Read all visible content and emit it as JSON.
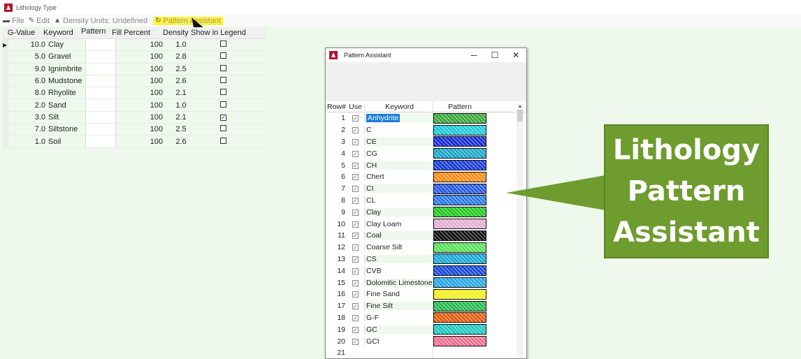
{
  "window": {
    "title": "Lithology Type"
  },
  "menu": {
    "items": [
      {
        "label": "File",
        "icon": "file-icon"
      },
      {
        "label": "Edit",
        "icon": "edit-icon"
      },
      {
        "label": "Density Units: Undefined",
        "icon": "weight-icon"
      },
      {
        "label": "Pattern Assistant",
        "icon": "refresh-icon"
      }
    ]
  },
  "grid": {
    "columns": [
      "G-Value",
      "Keyword",
      "Pattern",
      "Fill Percent",
      "Density",
      "Show in Legend"
    ],
    "rows": [
      {
        "g": "10.0",
        "kw": "Clay",
        "fill": "100",
        "den": "1.0",
        "legend": ""
      },
      {
        "g": "5.0",
        "kw": "Gravel",
        "fill": "100",
        "den": "2.8",
        "legend": ""
      },
      {
        "g": "9.0",
        "kw": "Ignimbrite",
        "fill": "100",
        "den": "2.5",
        "legend": ""
      },
      {
        "g": "6.0",
        "kw": "Mudstone",
        "fill": "100",
        "den": "2.6",
        "legend": ""
      },
      {
        "g": "8.0",
        "kw": "Rhyolite",
        "fill": "100",
        "den": "2.1",
        "legend": ""
      },
      {
        "g": "2.0",
        "kw": "Sand",
        "fill": "100",
        "den": "1.0",
        "legend": ""
      },
      {
        "g": "3.0",
        "kw": "Silt",
        "fill": "100",
        "den": "2.1",
        "legend": "✓"
      },
      {
        "g": "7.0",
        "kw": "Siltstone",
        "fill": "100",
        "den": "2.5",
        "legend": ""
      },
      {
        "g": "1.0",
        "kw": "Soil",
        "fill": "100",
        "den": "2.6",
        "legend": ""
      }
    ]
  },
  "dialog": {
    "title": "Pattern Assistant",
    "controls": {
      "minimize": "─",
      "maximize": "☐",
      "close": "✕"
    },
    "columns": [
      "Row#",
      "Use",
      "Keyword",
      "Pattern"
    ],
    "rows": [
      {
        "n": "1",
        "use": "✓",
        "kw": "Anhydrite",
        "color": "#3aa83a"
      },
      {
        "n": "2",
        "use": "✓",
        "kw": "C",
        "color": "#20c8d8"
      },
      {
        "n": "3",
        "use": "✓",
        "kw": "CE",
        "color": "#1a2cd8"
      },
      {
        "n": "4",
        "use": "✓",
        "kw": "CG",
        "color": "#1aa8c8"
      },
      {
        "n": "5",
        "use": "✓",
        "kw": "CH",
        "color": "#1a3cd8"
      },
      {
        "n": "6",
        "use": "✓",
        "kw": "Chert",
        "color": "#ff8c1a"
      },
      {
        "n": "7",
        "use": "✓",
        "kw": "CI",
        "color": "#2a5ae8"
      },
      {
        "n": "8",
        "use": "✓",
        "kw": "CL",
        "color": "#2a7ae8"
      },
      {
        "n": "9",
        "use": "✓",
        "kw": "Clay",
        "color": "#22c822"
      },
      {
        "n": "10",
        "use": "✓",
        "kw": "Clay Loam",
        "color": "#e0b0d0"
      },
      {
        "n": "11",
        "use": "✓",
        "kw": "Coal",
        "color": "#111111"
      },
      {
        "n": "12",
        "use": "✓",
        "kw": "Coarse Silt",
        "color": "#5ae05a"
      },
      {
        "n": "13",
        "use": "✓",
        "kw": "CS",
        "color": "#18a8d8"
      },
      {
        "n": "14",
        "use": "✓",
        "kw": "CVB",
        "color": "#1a4ad8"
      },
      {
        "n": "15",
        "use": "✓",
        "kw": "Dolomitic Limestone",
        "color": "#2aa8e8"
      },
      {
        "n": "16",
        "use": "✓",
        "kw": "Fine Sand",
        "color": "#f0f020"
      },
      {
        "n": "17",
        "use": "✓",
        "kw": "Fine Silt",
        "color": "#28b850"
      },
      {
        "n": "18",
        "use": "✓",
        "kw": "G-F",
        "color": "#e06010"
      },
      {
        "n": "19",
        "use": "✓",
        "kw": "GC",
        "color": "#20c8c0"
      },
      {
        "n": "20",
        "use": "✓",
        "kw": "GCI",
        "color": "#f07090"
      },
      {
        "n": "21",
        "use": "",
        "kw": "",
        "color": ""
      }
    ]
  },
  "callout": {
    "line1": "Lithology",
    "line2": "Pattern",
    "line3": "Assistant"
  }
}
